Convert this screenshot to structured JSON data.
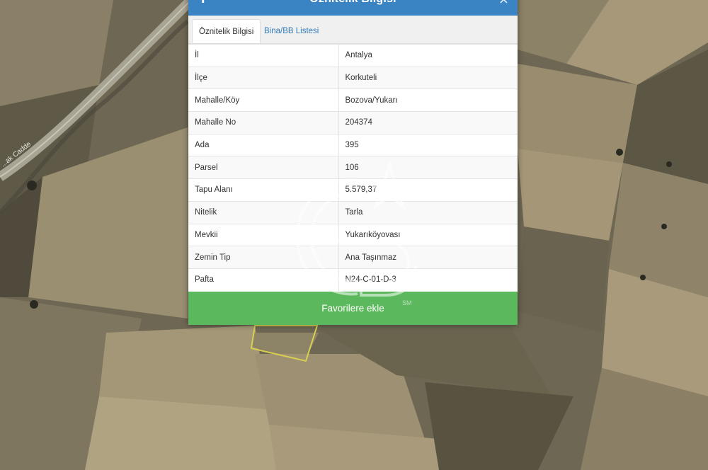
{
  "map": {
    "street_label": "...ak Cadde"
  },
  "modal": {
    "title": "Öznitelik Bilgisi",
    "info_icon": "i",
    "close_icon": "×",
    "tabs": [
      {
        "label": "Öznitelik Bilgisi",
        "active": true
      },
      {
        "label": "Bina/BB Listesi",
        "active": false
      }
    ],
    "rows": [
      {
        "key": "İl",
        "value": "Antalya"
      },
      {
        "key": "İlçe",
        "value": "Korkuteli"
      },
      {
        "key": "Mahalle/Köy",
        "value": "Bozova/Yukarı"
      },
      {
        "key": "Mahalle No",
        "value": "204374"
      },
      {
        "key": "Ada",
        "value": "395"
      },
      {
        "key": "Parsel",
        "value": "106"
      },
      {
        "key": "Tapu Alanı",
        "value": "5.579,37"
      },
      {
        "key": "Nitelik",
        "value": "Tarla"
      },
      {
        "key": "Mevkii",
        "value": "Yukarıköyovası"
      },
      {
        "key": "Zemin Tip",
        "value": "Ana Taşınmaz"
      },
      {
        "key": "Pafta",
        "value": "N24-C-01-D-3"
      }
    ],
    "favorite_button": "Favorilere ekle"
  },
  "watermark": {
    "mark": "SM"
  },
  "colors": {
    "header_blue": "#3a84c3",
    "button_green": "#5cb85c",
    "link_blue": "#337ab7"
  }
}
